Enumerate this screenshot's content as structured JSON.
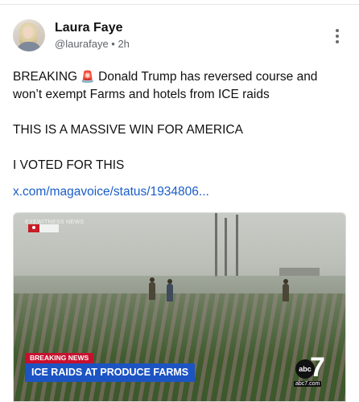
{
  "author": {
    "name": "Laura Faye",
    "handle_time": "@laurafaye • 2h"
  },
  "post": {
    "line1_prefix": "BREAKING",
    "siren": "🚨",
    "line1_rest": "Donald Trump has reversed course and won’t exempt Farms and hotels from ICE raids",
    "line2": "THIS IS A MASSIVE WIN FOR AMERICA",
    "line3": "I VOTED FOR THIS",
    "link": "x.com/magavoice/status/1934806..."
  },
  "media": {
    "stamp": "EYEWITNESS NEWS",
    "breaking_label": "BREAKING NEWS",
    "headline": "ICE RAIDS AT PRODUCE FARMS",
    "logo_circle": "abc",
    "logo_number": "7",
    "logo_site": "abc7.com"
  },
  "colors": {
    "link": "#1a5dc8",
    "breaking_red": "#c8102e",
    "lower_third_blue": "#1c54c4"
  }
}
